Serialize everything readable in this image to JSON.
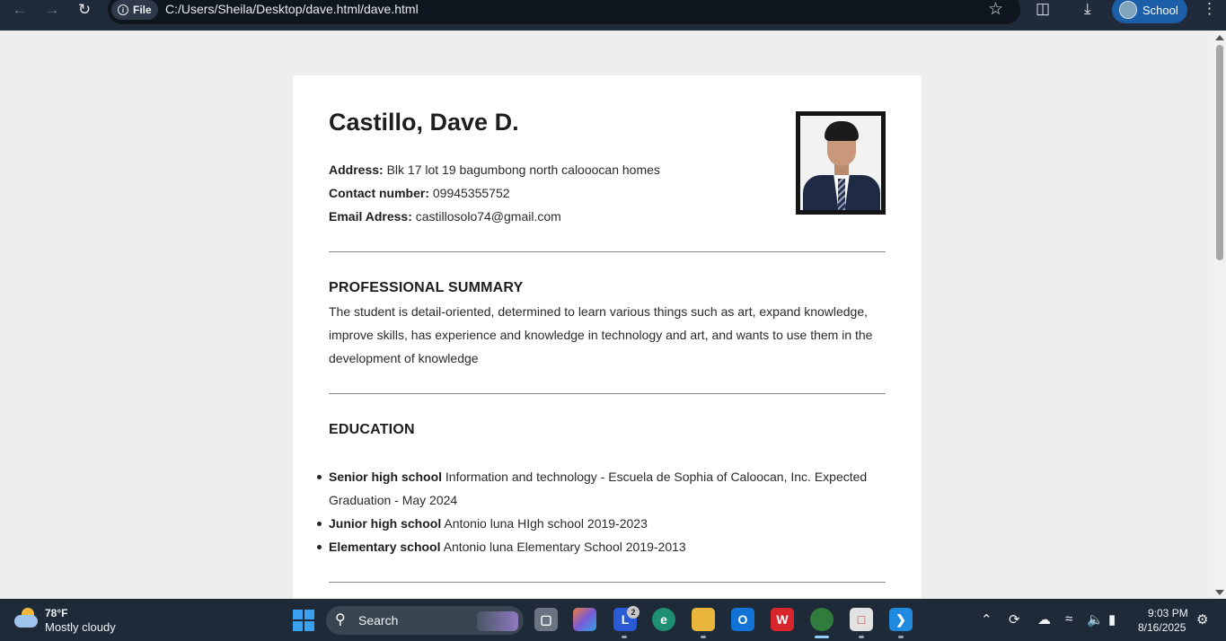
{
  "browser": {
    "file_chip": "File",
    "info_icon": "i",
    "url": "C:/Users/Sheila/Desktop/dave.html/dave.html",
    "profile_label": "School",
    "icons": [
      "back-arrow-icon",
      "forward-arrow-icon",
      "reload-icon",
      "bookmark-star-icon",
      "extensions-icon",
      "download-icon",
      "menu-kebab-icon"
    ]
  },
  "resume": {
    "name": "Castillo, Dave D.",
    "address_label": "Address:",
    "address_value": "Blk 17 lot 19 bagumbong north calooocan homes",
    "contact_label": "Contact number:",
    "contact_value": "09945355752",
    "email_label": "Email Adress:",
    "email_value": "castillosolo74@gmail.com",
    "summary_title": "PROFESSIONAL SUMMARY",
    "summary_text": "The student is detail-oriented, determined to learn various things such as art, expand knowledge, improve skills, has experience and knowledge in technology and art, and wants to use them in the development of knowledge",
    "education_title": "EDUCATION",
    "education": [
      {
        "level": "Senior high school",
        "detail": "Information and technology - Escuela de Sophia of Caloocan, Inc. Expected Graduation - May 2024"
      },
      {
        "level": "Junior high school",
        "detail": "Antonio luna HIgh school 2019-2023"
      },
      {
        "level": "Elementary school",
        "detail": "Antonio luna Elementary School 2019-2013"
      }
    ]
  },
  "taskbar": {
    "temperature": "78°F",
    "condition": "Mostly cloudy",
    "search_label": "Search",
    "notification_badge": "2",
    "time": "9:03 PM",
    "date": "8/16/2025"
  },
  "colors": {
    "browser_bar": "#1f2b3a",
    "page_bg": "#efeeee",
    "profile_chip": "#1c5fa8",
    "taskbar": "#1e2a37"
  }
}
